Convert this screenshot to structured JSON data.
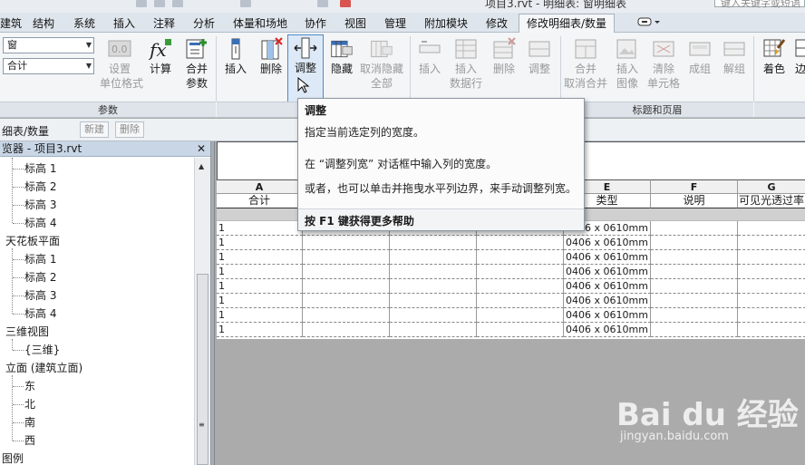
{
  "window": {
    "title": "项目3.rvt - 明细表: 窗明细表",
    "search_placeholder": "键入关键字或短语"
  },
  "tabs": [
    {
      "label": "建筑"
    },
    {
      "label": "结构"
    },
    {
      "label": "系统"
    },
    {
      "label": "插入"
    },
    {
      "label": "注释"
    },
    {
      "label": "分析"
    },
    {
      "label": "体量和场地"
    },
    {
      "label": "协作"
    },
    {
      "label": "视图"
    },
    {
      "label": "管理"
    },
    {
      "label": "附加模块"
    },
    {
      "label": "修改"
    },
    {
      "label": "修改明细表/数量"
    }
  ],
  "ribbon": {
    "type_selector": "窗",
    "field_selector": "合计",
    "buttons": {
      "set_unit_format": "设置",
      "set_unit_format_2": "单位格式",
      "calculate": "计算",
      "merge_params": "合并",
      "merge_params_2": "参数",
      "insert_col": "插入",
      "delete_col": "删除",
      "resize": "调整",
      "hide": "隐藏",
      "unhide_all": "取消隐藏",
      "unhide_all_2": "全部",
      "insert_row": "插入",
      "insert_data_row": "插入",
      "insert_data_row_2": "数据行",
      "delete_row": "删除",
      "resize_row": "调整",
      "merge_unmerge": "合并",
      "merge_unmerge_2": "取消合并",
      "insert_image": "插入",
      "insert_image_2": "图像",
      "clear_cell": "清除",
      "clear_cell_2": "单元格",
      "group": "成组",
      "ungroup": "解组",
      "shading": "着色",
      "borders": "边"
    },
    "panels": {
      "parameters": "参数",
      "titles_headers": "标题和页眉"
    }
  },
  "context_bar": {
    "title": "细表/数量",
    "new_label": "新建",
    "delete_label": "删除"
  },
  "browser": {
    "title": "览器 - 项目3.rvt",
    "close": "✕",
    "items": [
      {
        "label": "标高 1"
      },
      {
        "label": "标高 2"
      },
      {
        "label": "标高 3"
      },
      {
        "label": "标高 4"
      },
      {
        "label": "天花板平面"
      },
      {
        "label": "标高 1"
      },
      {
        "label": "标高 2"
      },
      {
        "label": "标高 3"
      },
      {
        "label": "标高 4"
      },
      {
        "label": "三维视图"
      },
      {
        "label": "{三维}"
      },
      {
        "label": "立面 (建筑立面)"
      },
      {
        "label": "东"
      },
      {
        "label": "北"
      },
      {
        "label": "南"
      },
      {
        "label": "西"
      },
      {
        "label": "图例"
      }
    ]
  },
  "schedule": {
    "col_letters": [
      "A",
      "B",
      "C",
      "D",
      "E",
      "F",
      "G"
    ],
    "col_headers": [
      "合计",
      "",
      "",
      "",
      "类型",
      "说明",
      "可见光透过率"
    ],
    "rows": [
      [
        "1",
        "",
        "",
        "",
        "0406 x 0610mm",
        "",
        ""
      ],
      [
        "1",
        "",
        "",
        "",
        "0406 x 0610mm",
        "",
        ""
      ],
      [
        "1",
        "",
        "",
        "",
        "0406 x 0610mm",
        "",
        ""
      ],
      [
        "1",
        "",
        "",
        "",
        "0406 x 0610mm",
        "",
        ""
      ],
      [
        "1",
        "",
        "",
        "",
        "0406 x 0610mm",
        "",
        ""
      ],
      [
        "1",
        "",
        "",
        "",
        "0406 x 0610mm",
        "",
        ""
      ],
      [
        "1",
        "",
        "",
        "",
        "0406 x 0610mm",
        "",
        ""
      ],
      [
        "1",
        "",
        "",
        "",
        "0406 x 0610mm",
        "",
        ""
      ]
    ]
  },
  "tooltip": {
    "title": "调整",
    "line1": "指定当前选定列的宽度。",
    "line2": "在 “调整列宽” 对话框中输入列的宽度。",
    "line3": "或者，也可以单击并拖曳水平列边界，来手动调整列宽。",
    "footer": "按 F1 键获得更多帮助"
  },
  "watermark": {
    "brand": "Bai du 经验",
    "url": "jingyan.baidu.com"
  }
}
